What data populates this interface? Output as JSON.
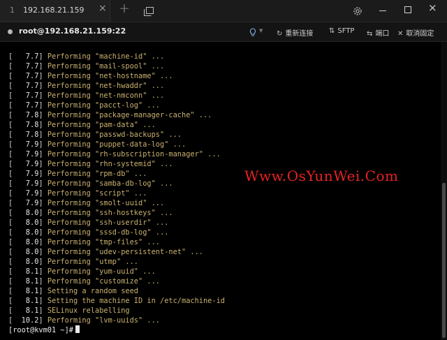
{
  "window": {
    "tab_number": "1",
    "tab_title": "192.168.21.159",
    "tab_close": "×",
    "new_tab": "+",
    "tab_list_icon": "tab-list-icon",
    "settings_icon": "gear-icon",
    "close_glyph": "×"
  },
  "session": {
    "title": "root@192.168.21.159:22",
    "status_color": "#b8b8b8",
    "tools": [
      {
        "label": "重新连接",
        "icon": "↻"
      },
      {
        "label": "SFTP",
        "icon": "⇅"
      },
      {
        "label": "端口",
        "icon": "⇆"
      },
      {
        "label": "取消固定",
        "icon": "✕"
      }
    ]
  },
  "terminal": {
    "lines": [
      {
        "ts": "   7.7",
        "msg": "Performing \"machine-id\" ..."
      },
      {
        "ts": "   7.7",
        "msg": "Performing \"mail-spool\" ..."
      },
      {
        "ts": "   7.7",
        "msg": "Performing \"net-hostname\" ..."
      },
      {
        "ts": "   7.7",
        "msg": "Performing \"net-hwaddr\" ..."
      },
      {
        "ts": "   7.7",
        "msg": "Performing \"net-nmconn\" ..."
      },
      {
        "ts": "   7.7",
        "msg": "Performing \"pacct-log\" ..."
      },
      {
        "ts": "   7.8",
        "msg": "Performing \"package-manager-cache\" ..."
      },
      {
        "ts": "   7.8",
        "msg": "Performing \"pam-data\" ..."
      },
      {
        "ts": "   7.8",
        "msg": "Performing \"passwd-backups\" ..."
      },
      {
        "ts": "   7.9",
        "msg": "Performing \"puppet-data-log\" ..."
      },
      {
        "ts": "   7.9",
        "msg": "Performing \"rh-subscription-manager\" ..."
      },
      {
        "ts": "   7.9",
        "msg": "Performing \"rhn-systemid\" ..."
      },
      {
        "ts": "   7.9",
        "msg": "Performing \"rpm-db\" ..."
      },
      {
        "ts": "   7.9",
        "msg": "Performing \"samba-db-log\" ..."
      },
      {
        "ts": "   7.9",
        "msg": "Performing \"script\" ..."
      },
      {
        "ts": "   7.9",
        "msg": "Performing \"smolt-uuid\" ..."
      },
      {
        "ts": "   8.0",
        "msg": "Performing \"ssh-hostkeys\" ..."
      },
      {
        "ts": "   8.0",
        "msg": "Performing \"ssh-userdir\" ..."
      },
      {
        "ts": "   8.0",
        "msg": "Performing \"sssd-db-log\" ..."
      },
      {
        "ts": "   8.0",
        "msg": "Performing \"tmp-files\" ..."
      },
      {
        "ts": "   8.0",
        "msg": "Performing \"udev-persistent-net\" ..."
      },
      {
        "ts": "   8.0",
        "msg": "Performing \"utmp\" ..."
      },
      {
        "ts": "   8.1",
        "msg": "Performing \"yum-uuid\" ..."
      },
      {
        "ts": "   8.1",
        "msg": "Performing \"customize\" ..."
      },
      {
        "ts": "   8.1",
        "msg": "Setting a random seed"
      },
      {
        "ts": "   8.1",
        "msg": "Setting the machine ID in /etc/machine-id"
      },
      {
        "ts": "   8.1",
        "msg": "SELinux relabelling"
      },
      {
        "ts": "  10.2",
        "msg": "Performing \"lvm-uuids\" ..."
      }
    ],
    "prompt": "[root@kvm01 ~]#"
  },
  "watermark": "Www.OsYunWei.Com",
  "colors": {
    "background": "#000000",
    "message_text": "#c9b16f",
    "watermark": "#e62222"
  }
}
